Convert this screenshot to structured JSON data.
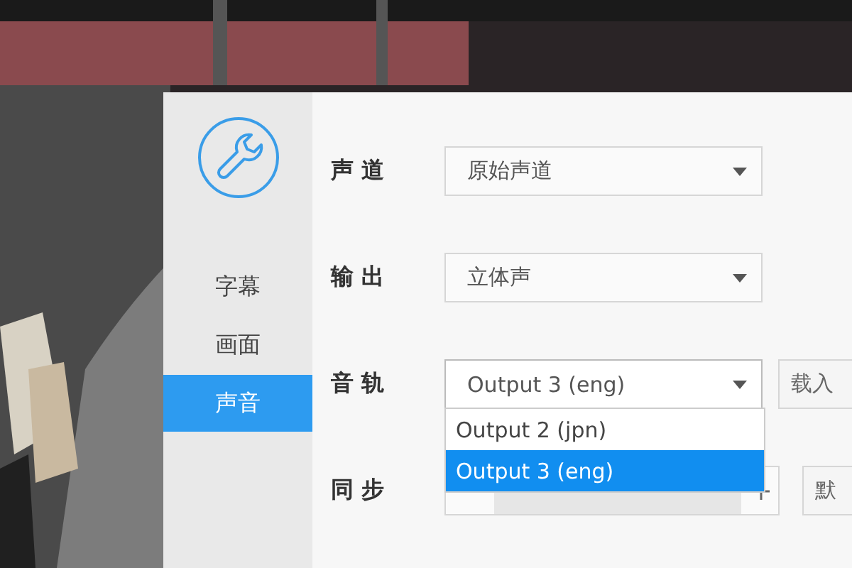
{
  "sidebar": {
    "items": [
      {
        "label": "字幕",
        "selected": false
      },
      {
        "label": "画面",
        "selected": false
      },
      {
        "label": "声音",
        "selected": true
      }
    ]
  },
  "settings": [
    {
      "kind": "dropdown",
      "label": "声 道",
      "value": "原始声道"
    },
    {
      "kind": "dropdown",
      "label": "输 出",
      "value": "立体声"
    },
    {
      "kind": "dropdown",
      "label": "音 轨",
      "value": "Output 3 (eng)",
      "button": "载入",
      "expanded": true,
      "options": [
        {
          "label": "Output 2 (jpn)",
          "selected": false
        },
        {
          "label": "Output 3 (eng)",
          "selected": true
        }
      ]
    },
    {
      "kind": "spinner",
      "label": "同 步",
      "button": "默"
    }
  ]
}
